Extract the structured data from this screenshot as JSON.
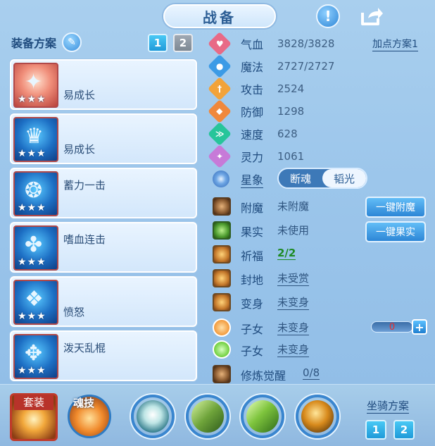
{
  "title": "战备",
  "left": {
    "scheme_label": "装备方案",
    "scheme_tabs": [
      "1",
      "2"
    ],
    "equipment": [
      {
        "name": "易成长",
        "stars": "★★★"
      },
      {
        "name": "易成长",
        "stars": "★★★"
      },
      {
        "name": "蓄力一击",
        "stars": "★★★"
      },
      {
        "name": "嗜血连击",
        "stars": "★★★"
      },
      {
        "name": "愤怒",
        "stars": "★★★"
      },
      {
        "name": "泼天乱棍",
        "stars": "★★★"
      }
    ]
  },
  "add_plan": "加点方案1",
  "stats": [
    {
      "label": "气血",
      "value": "3828/3828",
      "icon": "heart-icon",
      "color": "#e86a86"
    },
    {
      "label": "魔法",
      "value": "2727/2727",
      "icon": "mana-icon",
      "color": "#3c9be6"
    },
    {
      "label": "攻击",
      "value": "2524",
      "icon": "sword-icon",
      "color": "#f2a33a"
    },
    {
      "label": "防御",
      "value": "1298",
      "icon": "shield-icon",
      "color": "#f0883c"
    },
    {
      "label": "速度",
      "value": "628",
      "icon": "speed-icon",
      "color": "#27c59a"
    },
    {
      "label": "灵力",
      "value": "1061",
      "icon": "spirit-icon",
      "color": "#c77ad8"
    }
  ],
  "xingxiang": {
    "label": "星象",
    "options": [
      "断魂",
      "韬光"
    ],
    "selected": "韬光"
  },
  "attrs": [
    {
      "label": "附魔",
      "value": "未附魔"
    },
    {
      "label": "果实",
      "value": "未使用"
    },
    {
      "label": "祈福",
      "value": "2/2"
    },
    {
      "label": "封地",
      "value": "未受赏"
    },
    {
      "label": "变身",
      "value": "未变身"
    },
    {
      "label": "子女",
      "value": "未变身"
    },
    {
      "label": "子女",
      "value": "未变身"
    },
    {
      "label": "修炼觉醒",
      "value": "0/8"
    }
  ],
  "buttons": {
    "enchant": "一键附魔",
    "fruit": "一键果实"
  },
  "counter": {
    "value": "0",
    "plus": "+"
  },
  "bottom": {
    "suit": "套装",
    "soul": "魂技",
    "ride_label": "坐骑方案",
    "ride_tabs": [
      "1",
      "2"
    ]
  },
  "help_glyph": "!"
}
